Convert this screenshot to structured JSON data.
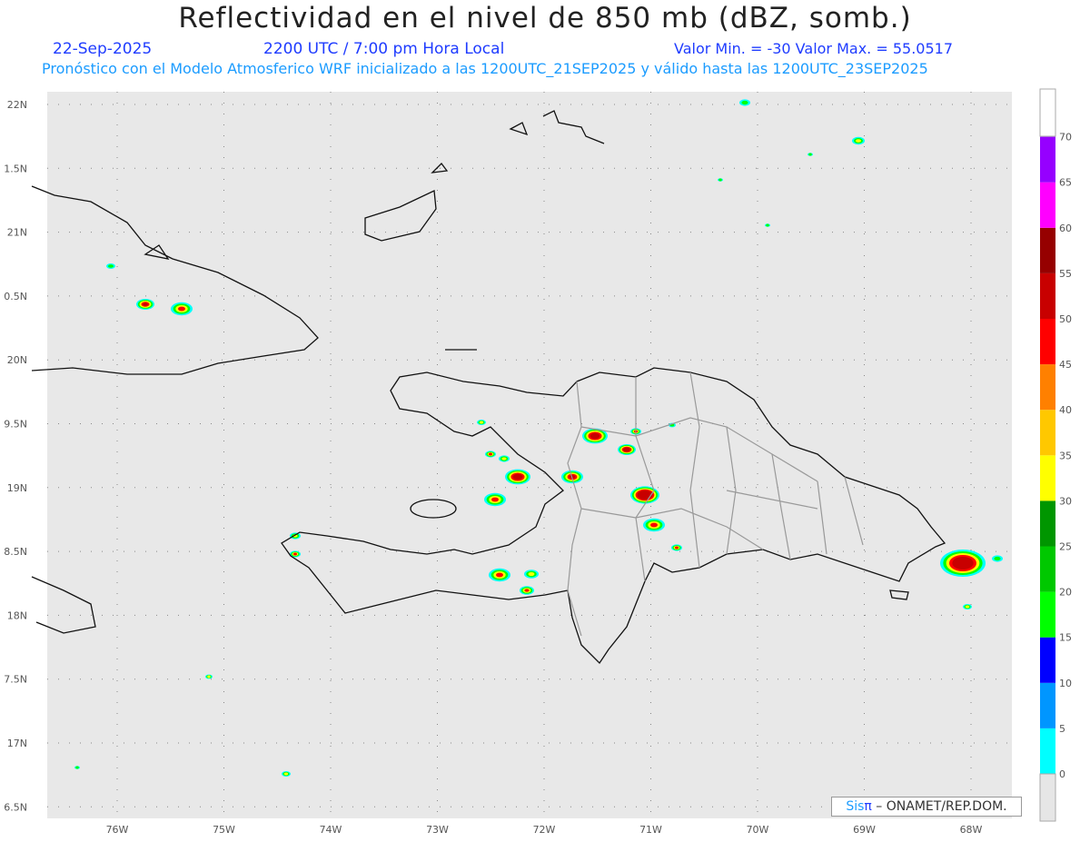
{
  "header": {
    "title": "Reflectividad en el nivel de 850 mb (dBZ, somb.)",
    "date": "22-Sep-2025",
    "time": "2200 UTC / 7:00 pm Hora Local",
    "min_max": "Valor Min. = -30  Valor Max. = 55.0517",
    "subtitle": "Pronóstico con el Modelo Atmosferico WRF inicializado a las 1200UTC_21SEP2025 y válido hasta las  1200UTC_23SEP2025"
  },
  "axes": {
    "lon_labels": [
      "76W",
      "75W",
      "74W",
      "73W",
      "72W",
      "71W",
      "70W",
      "69W",
      "68W"
    ],
    "lat_labels": [
      "22N",
      "1.5N",
      "21N",
      "0.5N",
      "20N",
      "9.5N",
      "19N",
      "8.5N",
      "18N",
      "7.5N",
      "17N",
      "6.5N"
    ]
  },
  "colorbar": {
    "labels": [
      "0",
      "5",
      "10",
      "15",
      "20",
      "25",
      "30",
      "35",
      "40",
      "45",
      "50",
      "55",
      "60",
      "65",
      "70"
    ],
    "colors": [
      "#00ffff",
      "#0096ff",
      "#0000ff",
      "#00ff00",
      "#00c800",
      "#009600",
      "#ffff00",
      "#ffc800",
      "#ff8000",
      "#ff0000",
      "#c80000",
      "#960000",
      "#ff00ff",
      "#9600ff"
    ],
    "below_color": "#e6e6e6",
    "above_color": "#ffffff"
  },
  "credit": {
    "sis": "Sis",
    "pi": "π",
    "rest": " – ONAMET/REP.DOM."
  }
}
